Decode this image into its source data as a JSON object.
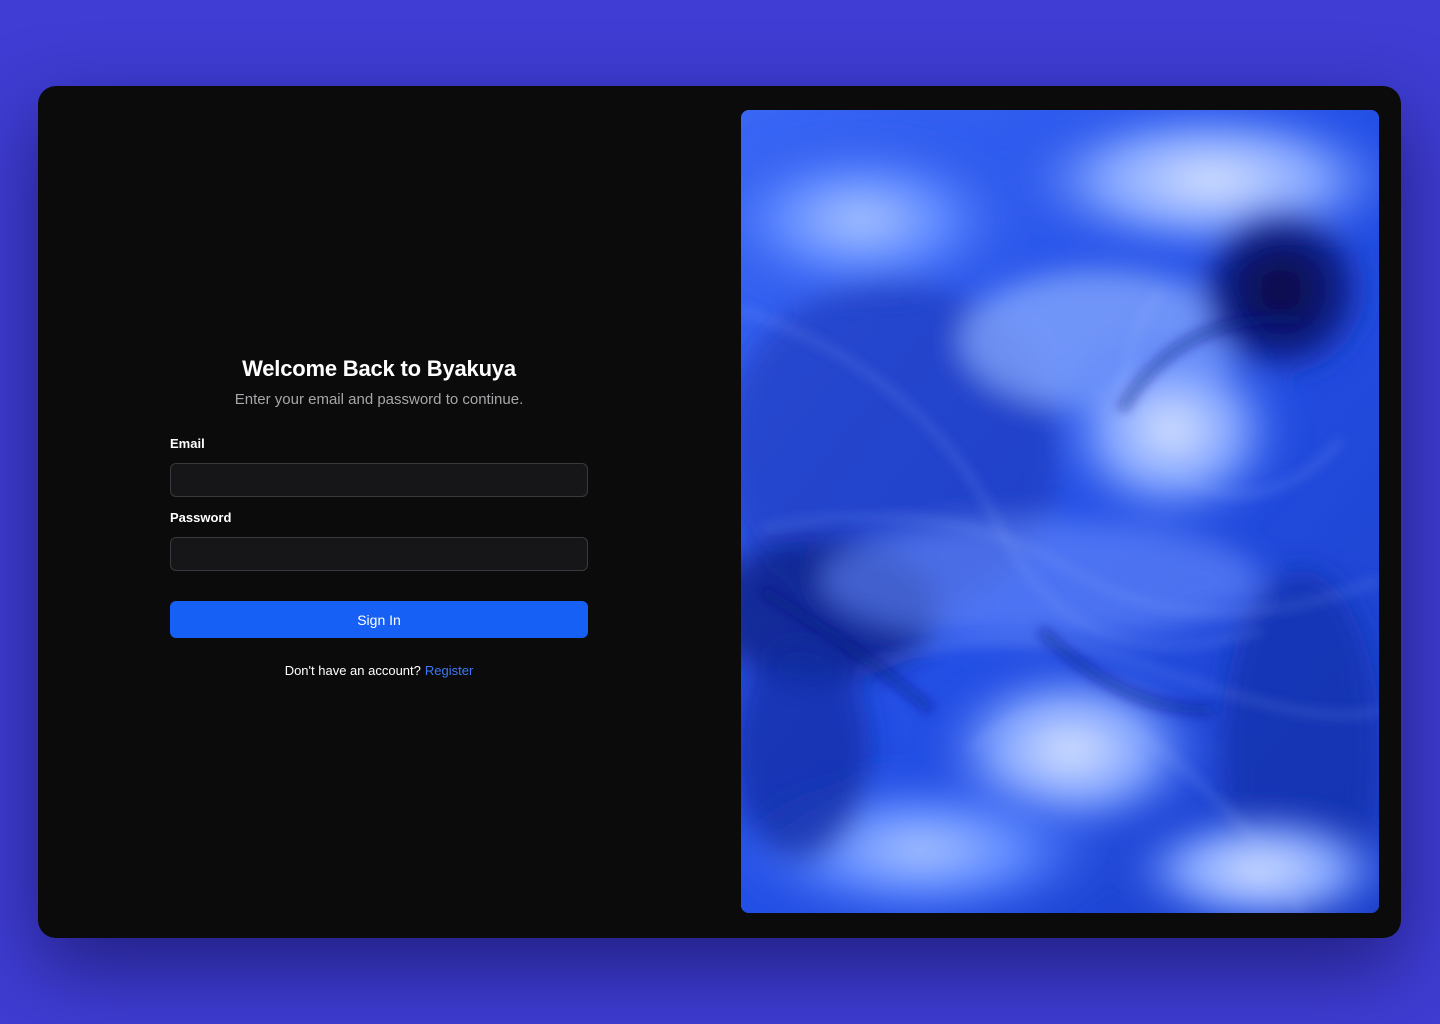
{
  "login": {
    "title": "Welcome Back to Byakuya",
    "subtitle": "Enter your email and password to continue.",
    "email_label": "Email",
    "email_value": "",
    "password_label": "Password",
    "password_value": "",
    "submit_label": "Sign In",
    "register_prompt": "Don't have an account?",
    "register_link": "Register"
  },
  "artwork": {
    "description_icon": "abstract-swirl-artwork"
  },
  "colors": {
    "page_background": "#3f3dd3",
    "window_background": "#0b0b0c",
    "primary_button": "#1660f5",
    "link": "#3f78f5",
    "artwork_base": "#2c56e8"
  }
}
